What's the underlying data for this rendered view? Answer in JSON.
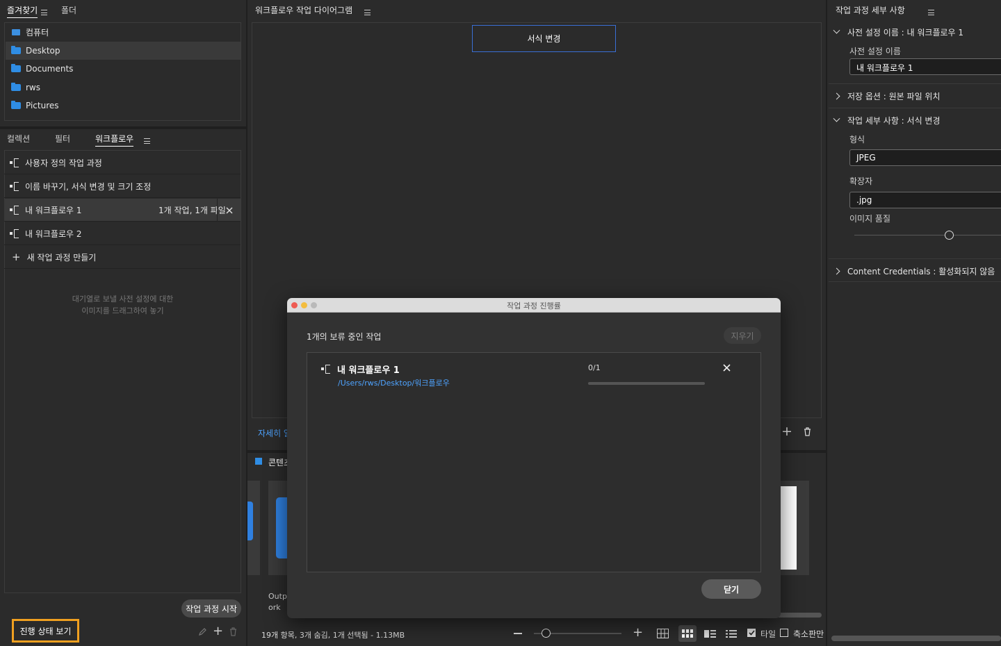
{
  "favorites": {
    "tabs": [
      "즐겨찾기",
      "폴더"
    ],
    "items": [
      "컴퓨터",
      "Desktop",
      "Documents",
      "rws",
      "Pictures"
    ]
  },
  "workflow_panel": {
    "tabs": [
      "컬렉션",
      "필터",
      "워크플로우"
    ],
    "items": [
      {
        "label": "사용자 정의 작업 과정"
      },
      {
        "label": "이름 바꾸기, 서식 변경 및 크기 조정"
      },
      {
        "label": "내 워크플로우 1",
        "meta": "1개 작업, 1개 파일"
      },
      {
        "label": "내 워크플로우 2"
      }
    ],
    "new_label": "새 작업 과정 만들기",
    "drop_hint_1": "대기열로 보낼 사전 설정에 대한",
    "drop_hint_2": "이미지를 드래그하여 놓기",
    "start_button": "작업 과정 시작",
    "progress_button": "진행 상태 보기"
  },
  "diagram": {
    "title": "워크플로우 작업 다이어그램",
    "node": "서식 변경",
    "learn_more": "자세히 알"
  },
  "content": {
    "title": "콘텐츠",
    "caption_1": "Outpu",
    "caption_2": "ork",
    "status": "19개 항목, 3개 숨김, 1개 선택됨 - 1.13MB",
    "tile_label": "타일",
    "thumb_label": "축소판만"
  },
  "details": {
    "title": "작업 과정 세부 사항",
    "preset_section": "사전 설정 이름 : 내 워크플로우 1",
    "preset_label": "사전 설정 이름",
    "preset_value": "내 워크플로우 1",
    "save_section": "저장 옵션 : 원본 파일 위치",
    "task_section": "작업 세부 사항 : 서식 변경",
    "format_label": "형식",
    "format_value": "JPEG",
    "ext_label": "확장자",
    "ext_value": ".jpg",
    "quality_label": "이미지 품질",
    "quality": 0.63,
    "cc_section": "Content Credentials : 활성화되지 않음"
  },
  "dialog": {
    "title": "작업 과정 진행률",
    "pending": "1개의 보류 중인 작업",
    "clear": "지우기",
    "job_name": "내 워크플로우 1",
    "job_path": "/Users/rws/Desktop/워크플로우",
    "job_count": "0/1",
    "job_progress": 0.0,
    "close": "닫기"
  },
  "colors": {
    "accent_blue": "#2f8de4",
    "highlight_orange": "#f0a020",
    "link_blue": "#4ea3ff"
  }
}
